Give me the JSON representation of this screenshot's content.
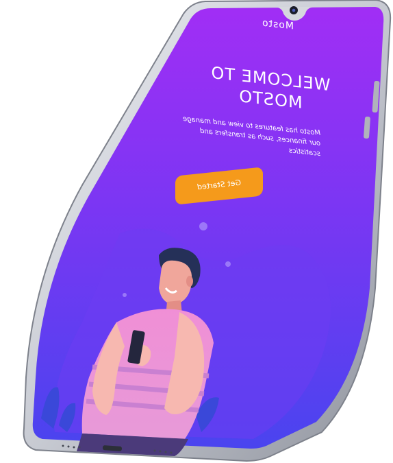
{
  "app": {
    "title": "Mosto"
  },
  "welcome": {
    "heading": "WELCOME TO MOSTO",
    "description": "Mosto has features to view and manage our finances, such as transfers and scatistics"
  },
  "cta": {
    "label": "Get Started"
  },
  "colors": {
    "screen_top": "#9b2cf2",
    "screen_bottom": "#4b42f0",
    "button": "#f59a1b",
    "phone_frame": "#c9ccd3"
  },
  "icons": {
    "camera": "camera-icon",
    "usb_port": "usb-port-icon",
    "speaker": "speaker-grille-icon"
  }
}
